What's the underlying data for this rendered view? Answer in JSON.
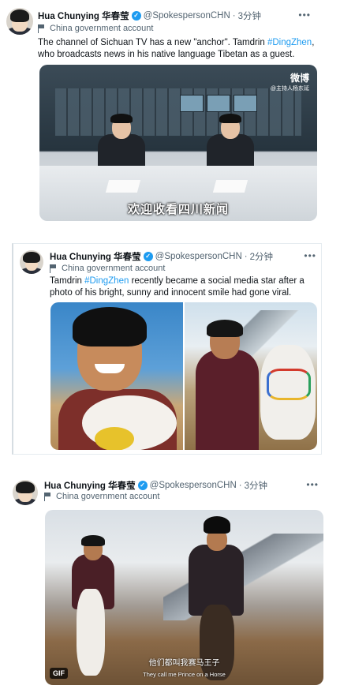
{
  "tweets": [
    {
      "author": {
        "name": "Hua Chunying 华春莹",
        "handle": "@SpokespersonCHN",
        "time": "3分钟",
        "label": "China government account"
      },
      "text": {
        "pre": "The channel of Sichuan TV has a new \"anchor\". Tamdrin ",
        "tag": "#DingZhen",
        "post": ", who broadcasts news in his native language Tibetan as a guest."
      },
      "media": {
        "watermark": "微博",
        "watermark_sub": "@主持人杨东延",
        "subtitle": "欢迎收看四川新闻"
      }
    },
    {
      "author": {
        "name": "Hua Chunying 华春莹",
        "handle": "@SpokespersonCHN",
        "time": "2分钟",
        "label": "China government account"
      },
      "text": {
        "pre": "Tamdrin ",
        "tag": "#DingZhen",
        "post": " recently became a social media star after a photo of his bright, sunny and innocent smile had gone viral."
      }
    },
    {
      "author": {
        "name": "Hua Chunying 华春莹",
        "handle": "@SpokespersonCHN",
        "time": "3分钟",
        "label": "China government account"
      },
      "media": {
        "badge": "GIF",
        "caption_cn": "他们都叫我赛马王子",
        "caption_en": "They call me Prince on a Horse"
      }
    }
  ],
  "ui": {
    "more": "•••",
    "dot": "·",
    "verified": "✓"
  },
  "colors": {
    "link": "#1d9bf0",
    "secondary": "#536471"
  }
}
